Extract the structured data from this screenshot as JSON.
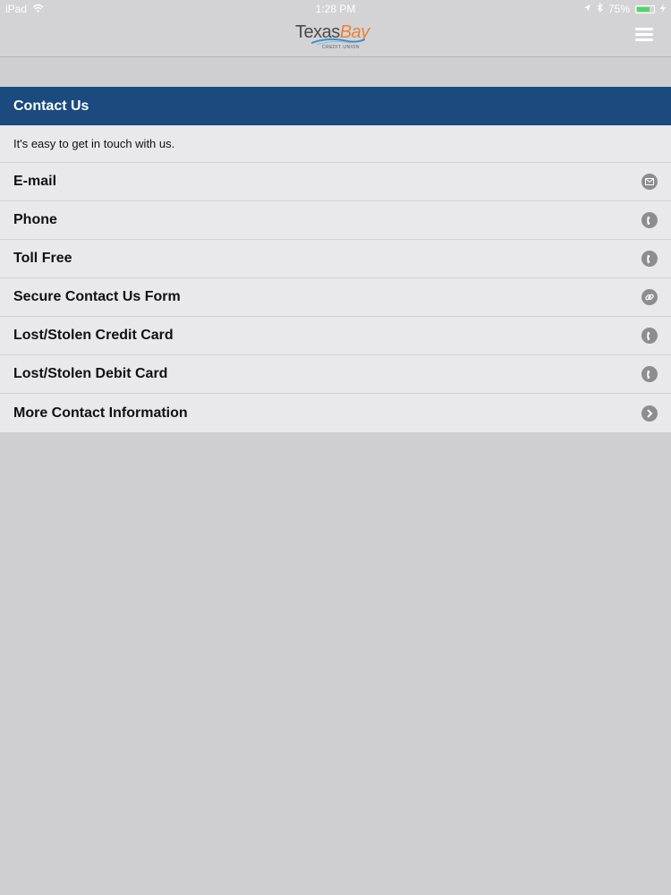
{
  "statusbar": {
    "device": "iPad",
    "time": "1:28 PM",
    "battery": "75%",
    "battery_level": 0.75
  },
  "header": {
    "logo": {
      "brand_part1": "Texas",
      "brand_part2": "Bay",
      "subtitle": "CREDIT UNION"
    },
    "menu_icon": "hamburger-menu-icon"
  },
  "colors": {
    "header_bg": "#d3d3d5",
    "section_bg": "#1b4a7f",
    "panel_bg": "#e9e8ea",
    "page_bg": "#cfced0",
    "icon_gray": "#8d8d8f",
    "logo_orange": "#e8823a",
    "logo_blue": "#3d8fc8"
  },
  "section": {
    "title": "Contact Us",
    "intro": "It's easy to get in touch with us."
  },
  "contacts": [
    {
      "label": "E-mail",
      "icon": "envelope-icon"
    },
    {
      "label": "Phone",
      "icon": "phone-icon"
    },
    {
      "label": "Toll Free",
      "icon": "phone-icon"
    },
    {
      "label": "Secure Contact Us Form",
      "icon": "link-icon"
    },
    {
      "label": "Lost/Stolen Credit Card",
      "icon": "phone-icon"
    },
    {
      "label": "Lost/Stolen Debit Card",
      "icon": "phone-icon"
    },
    {
      "label": "More Contact Information",
      "icon": "chevron-right-icon"
    }
  ]
}
